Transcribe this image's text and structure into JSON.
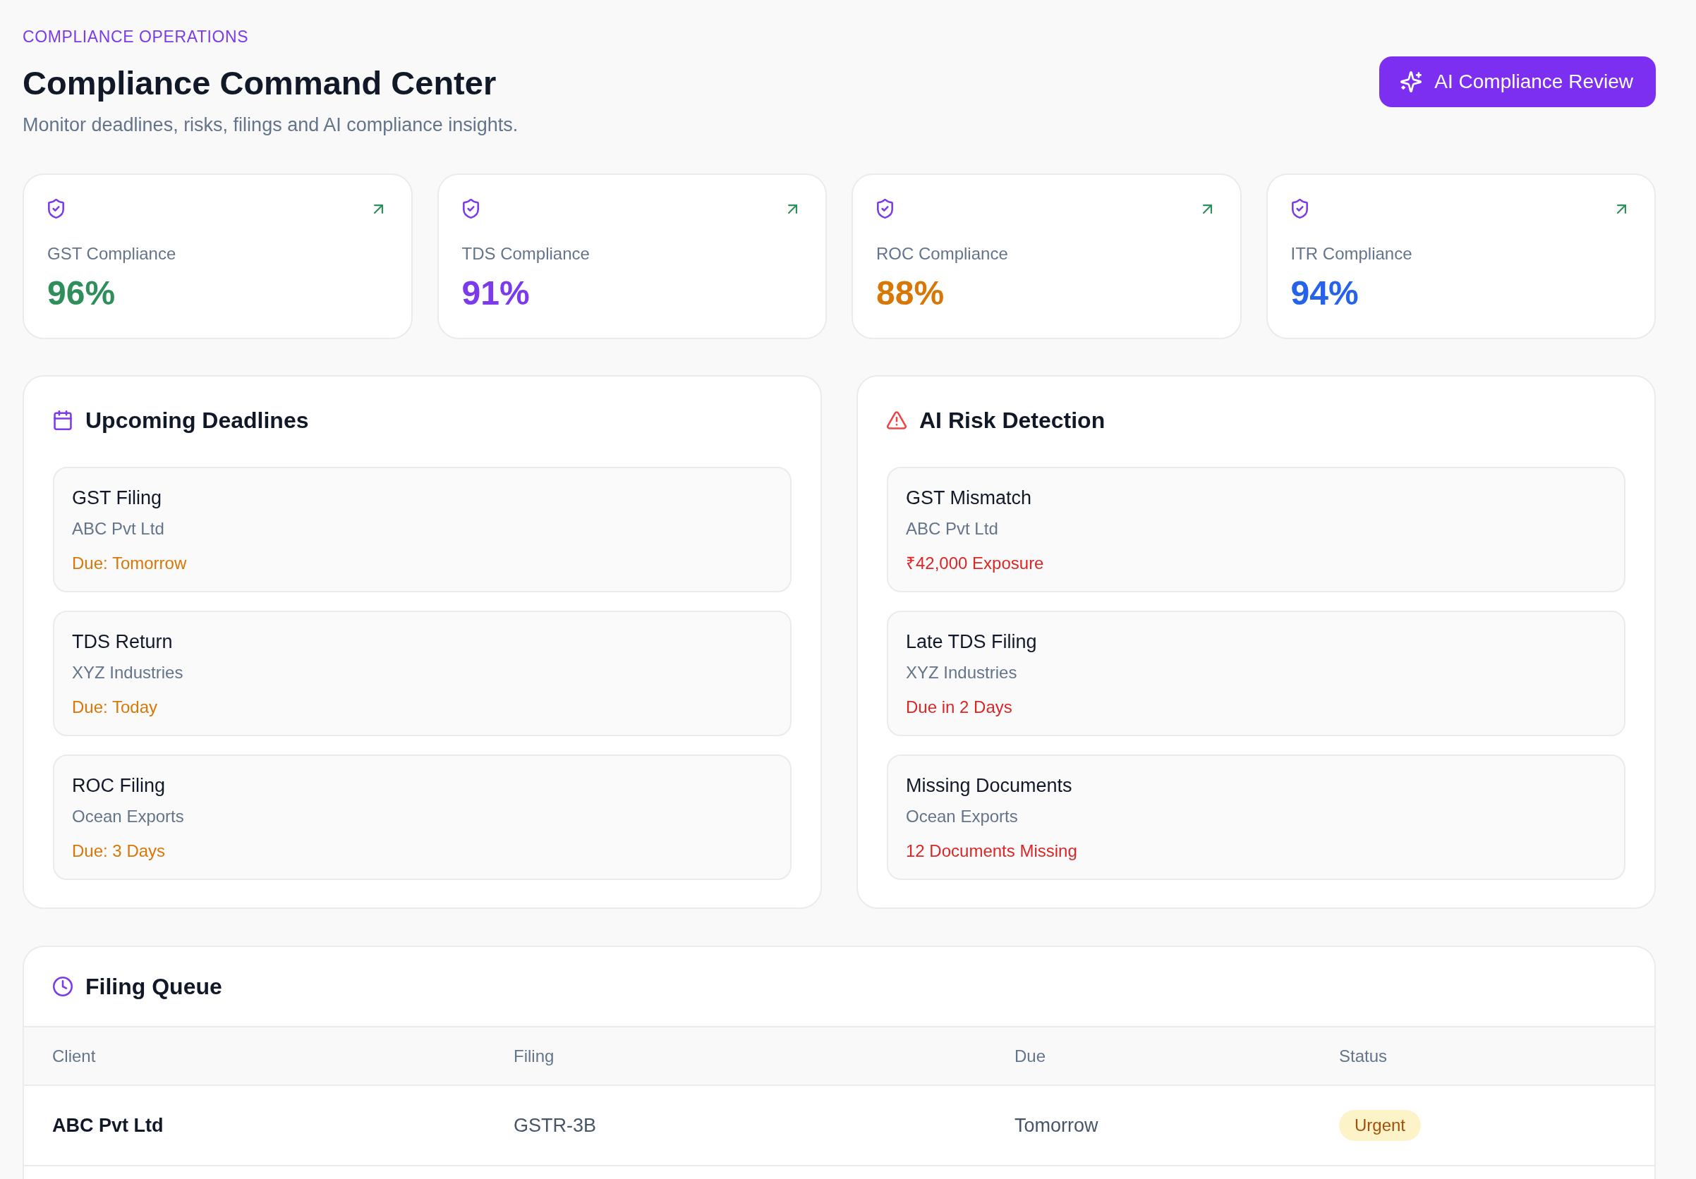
{
  "header": {
    "eyebrow": "COMPLIANCE OPERATIONS",
    "title": "Compliance Command Center",
    "subtitle": "Monitor deadlines, risks, filings and AI compliance insights.",
    "action_button": {
      "label": "AI Compliance Review"
    }
  },
  "stat_cards": [
    {
      "label": "GST Compliance",
      "value": "96%",
      "color": "#2f8f5b"
    },
    {
      "label": "TDS Compliance",
      "value": "91%",
      "color": "#7c3aed"
    },
    {
      "label": "ROC Compliance",
      "value": "88%",
      "color": "#d97706"
    },
    {
      "label": "ITR Compliance",
      "value": "94%",
      "color": "#2563eb"
    }
  ],
  "panels": [
    {
      "kind": "deadlines",
      "title": "Upcoming Deadlines",
      "items": [
        {
          "title": "GST Filing",
          "client": "ABC Pvt Ltd",
          "note": "Due: Tomorrow"
        },
        {
          "title": "TDS Return",
          "client": "XYZ Industries",
          "note": "Due: Today"
        },
        {
          "title": "ROC Filing",
          "client": "Ocean Exports",
          "note": "Due: 3 Days"
        }
      ]
    },
    {
      "kind": "risks",
      "title": "AI Risk Detection",
      "items": [
        {
          "title": "GST Mismatch",
          "client": "ABC Pvt Ltd",
          "note": "₹42,000 Exposure"
        },
        {
          "title": "Late TDS Filing",
          "client": "XYZ Industries",
          "note": "Due in 2 Days"
        },
        {
          "title": "Missing Documents",
          "client": "Ocean Exports",
          "note": "12 Documents Missing"
        }
      ]
    }
  ],
  "filing_queue": {
    "title": "Filing Queue",
    "columns": [
      "Client",
      "Filing",
      "Due",
      "Status"
    ],
    "rows": [
      {
        "client": "ABC Pvt Ltd",
        "filing": "GSTR-3B",
        "due": "Tomorrow",
        "status": "Urgent"
      }
    ]
  }
}
